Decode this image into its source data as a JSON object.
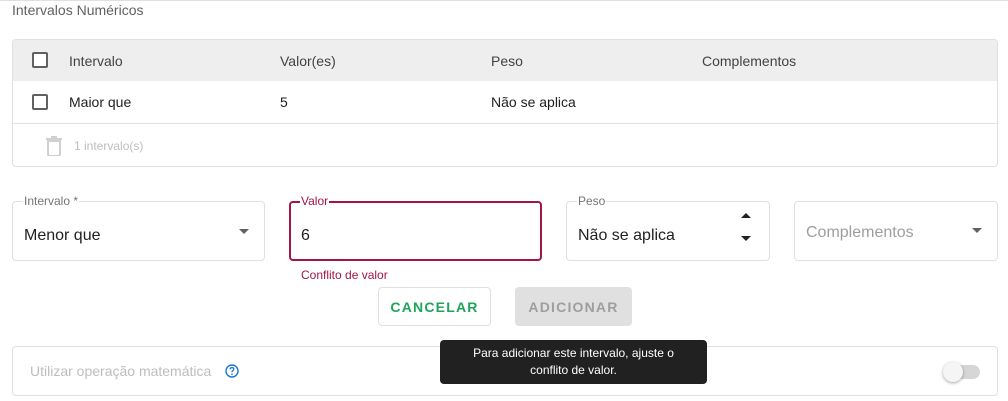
{
  "section_title": "Intervalos Numéricos",
  "table": {
    "headers": [
      "Intervalo",
      "Valor(es)",
      "Peso",
      "Complementos"
    ],
    "rows": [
      {
        "intervalo": "Maior que",
        "valores": "5",
        "peso": "Não se aplica",
        "complementos": ""
      }
    ],
    "footer_count": "1 intervalo(s)"
  },
  "form": {
    "intervalo": {
      "label": "Intervalo *",
      "value": "Menor que"
    },
    "valor": {
      "label": "Valor",
      "value": "6",
      "error": "Conflito de valor"
    },
    "peso": {
      "label": "Peso",
      "value": "Não se aplica"
    },
    "complementos": {
      "placeholder": "Complementos"
    }
  },
  "buttons": {
    "cancel": "CANCELAR",
    "add": "ADICIONAR"
  },
  "math_operation": {
    "label": "Utilizar operação matemática",
    "enabled": false
  },
  "tooltip": {
    "line1": "Para adicionar este intervalo, ajuste o",
    "line2": "conflito de valor."
  },
  "colors": {
    "error": "#a31545",
    "cancel_text": "#20a35a",
    "tooltip_bg": "#212121",
    "help_icon": "#1976d2"
  },
  "icons": [
    "checkbox-icon",
    "trash-icon",
    "dropdown-arrow-icon",
    "sort-arrows-icon",
    "help-icon",
    "toggle-switch"
  ]
}
